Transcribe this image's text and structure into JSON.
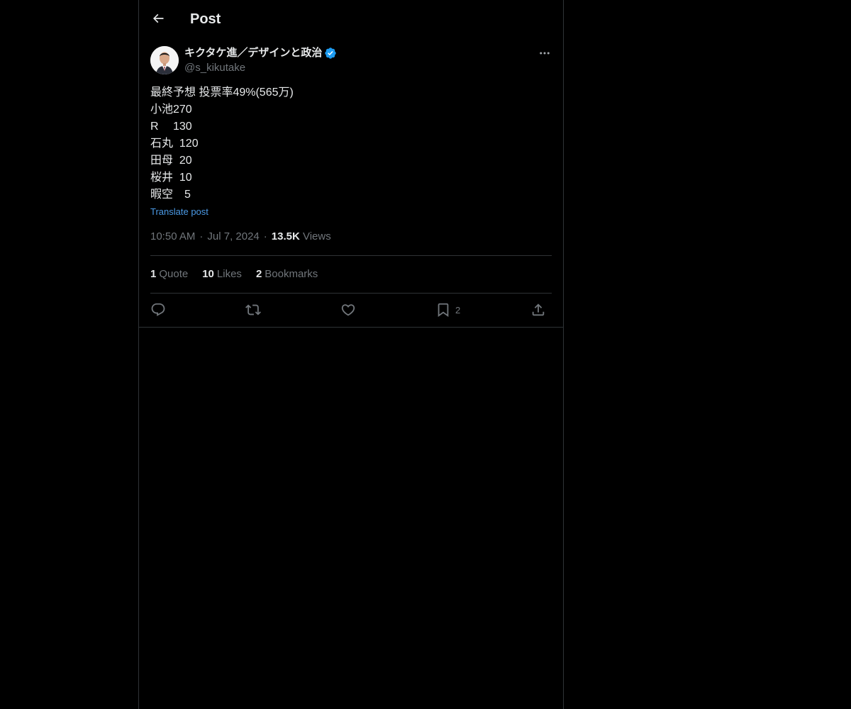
{
  "header": {
    "title": "Post",
    "back_icon": "arrow-left-icon"
  },
  "author": {
    "display_name": "キクタケ進／デザインと政治",
    "handle": "@s_kikutake",
    "verified": true,
    "verified_color": "#1d9bf0"
  },
  "post": {
    "lines": [
      "最終予想 投票率49%(565万)",
      "小池270",
      "R　 130",
      "石丸  120",
      "田母  20",
      "桜井  10",
      "暇空　5"
    ],
    "translate_label": "Translate post"
  },
  "meta": {
    "time": "10:50 AM",
    "date": "Jul 7, 2024",
    "views_count": "13.5K",
    "views_label": "Views"
  },
  "stats": [
    {
      "count": "1",
      "label": "Quote"
    },
    {
      "count": "10",
      "label": "Likes"
    },
    {
      "count": "2",
      "label": "Bookmarks"
    }
  ],
  "actions": {
    "reply_icon": "reply-icon",
    "repost_icon": "repost-icon",
    "like_icon": "heart-icon",
    "bookmark_icon": "bookmark-icon",
    "bookmark_count": "2",
    "share_icon": "share-icon"
  },
  "colors": {
    "background": "#000000",
    "text": "#e7e9ea",
    "muted": "#71767b",
    "link": "#4b9ae6",
    "border": "#2f3336"
  }
}
